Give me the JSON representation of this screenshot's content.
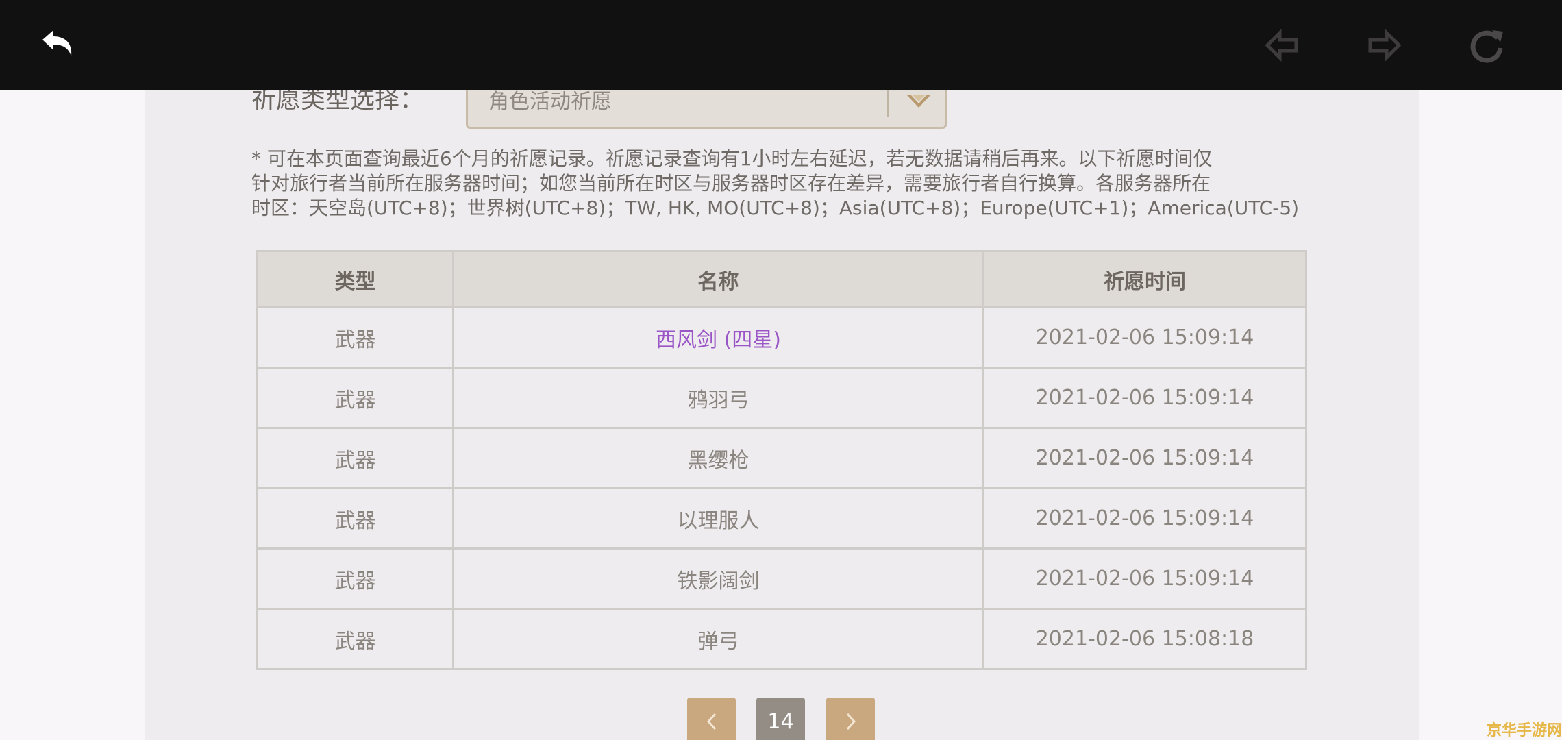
{
  "filter": {
    "label": "祈愿类型选择：",
    "selected": "角色活动祈愿"
  },
  "notice": {
    "lines": [
      "* 可在本页面查询最近6个月的祈愿记录。祈愿记录查询有1小时左右延迟，若无数据请稍后再来。以下祈愿时间仅",
      "针对旅行者当前所在服务器时间；如您当前所在时区与服务器时区存在差异，需要旅行者自行换算。各服务器所在",
      "时区：天空岛(UTC+8)；世界树(UTC+8)；TW, HK, MO(UTC+8)；Asia(UTC+8)；Europe(UTC+1)；America(UTC-5)"
    ]
  },
  "table": {
    "headers": [
      "类型",
      "名称",
      "祈愿时间"
    ],
    "rows": [
      {
        "type": "武器",
        "name": "西风剑 (四星)",
        "time": "2021-02-06 15:09:14",
        "highlight": "#9a55c6"
      },
      {
        "type": "武器",
        "name": "鸦羽弓",
        "time": "2021-02-06 15:09:14"
      },
      {
        "type": "武器",
        "name": "黑缨枪",
        "time": "2021-02-06 15:09:14"
      },
      {
        "type": "武器",
        "name": "以理服人",
        "time": "2021-02-06 15:09:14"
      },
      {
        "type": "武器",
        "name": "铁影阔剑",
        "time": "2021-02-06 15:09:14"
      },
      {
        "type": "武器",
        "name": "弹弓",
        "time": "2021-02-06 15:08:18"
      }
    ]
  },
  "pagination": {
    "current_page": "14"
  },
  "toolbar": {
    "icons": [
      "back-arrow-icon",
      "nav-back-icon",
      "nav-forward-icon",
      "reload-icon"
    ]
  },
  "watermark": "京华手游网",
  "colors": {
    "accent_gold": "#c9a77f",
    "highlight_purple": "#9a55c6",
    "panel_bg": "#efecef",
    "topbar_bg": "#121112"
  }
}
